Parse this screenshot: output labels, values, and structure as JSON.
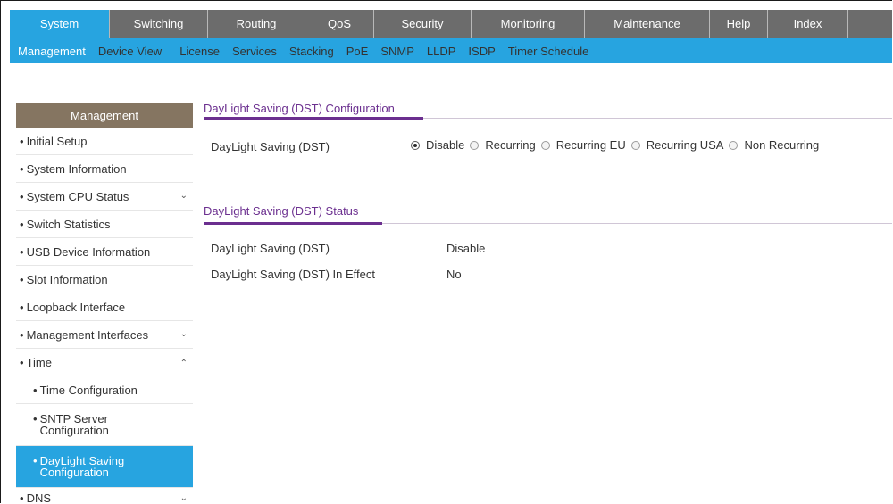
{
  "top_nav": [
    "System",
    "Switching",
    "Routing",
    "QoS",
    "Security",
    "Monitoring",
    "Maintenance",
    "Help",
    "Index"
  ],
  "sub_nav": [
    "Management",
    "Device View",
    "License",
    "Services",
    "Stacking",
    "PoE",
    "SNMP",
    "LLDP",
    "ISDP",
    "Timer Schedule"
  ],
  "sidebar": {
    "title": "Management",
    "items": [
      {
        "label": "Initial Setup"
      },
      {
        "label": "System Information"
      },
      {
        "label": "System CPU Status"
      },
      {
        "label": "Switch Statistics"
      },
      {
        "label": "USB Device Information"
      },
      {
        "label": "Slot Information"
      },
      {
        "label": "Loopback Interface"
      },
      {
        "label": "Management Interfaces"
      },
      {
        "label": "Time"
      },
      {
        "label": "Time Configuration"
      },
      {
        "label": "SNTP Server",
        "label2": "Configuration"
      },
      {
        "label": "DayLight Saving",
        "label2": "Configuration"
      },
      {
        "label": "DNS"
      }
    ]
  },
  "config": {
    "title": "DayLight Saving (DST) Configuration",
    "field_label": "DayLight Saving (DST)",
    "options": [
      "Disable",
      "Recurring",
      "Recurring EU",
      "Recurring USA",
      "Non Recurring"
    ],
    "selected": "Disable"
  },
  "status": {
    "title": "DayLight Saving (DST) Status",
    "rows": [
      {
        "label": "DayLight Saving (DST)",
        "value": "Disable"
      },
      {
        "label": "DayLight Saving (DST) In Effect",
        "value": "No"
      }
    ]
  },
  "colors": {
    "accent": "#27a4e0",
    "nav_bg": "#6c6c6c",
    "sidebar_header": "#857561",
    "section_title": "#6b2f8f"
  }
}
